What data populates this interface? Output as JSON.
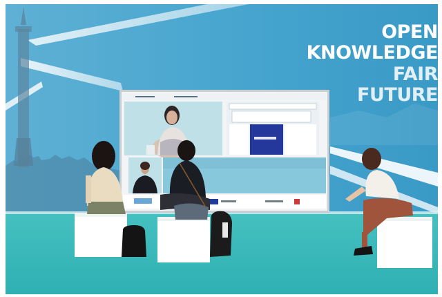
{
  "backdrop": {
    "lines": [
      "OPEN",
      "KNOWLEDGE",
      "FAIR",
      "FUTURE"
    ]
  },
  "screen": {
    "header_left": "",
    "header_center": ""
  },
  "colors": {
    "wall": "#3f9ec7",
    "floor": "#3cb6b8",
    "screen_bezel": "#d9dde0",
    "text": "#ffffff"
  }
}
